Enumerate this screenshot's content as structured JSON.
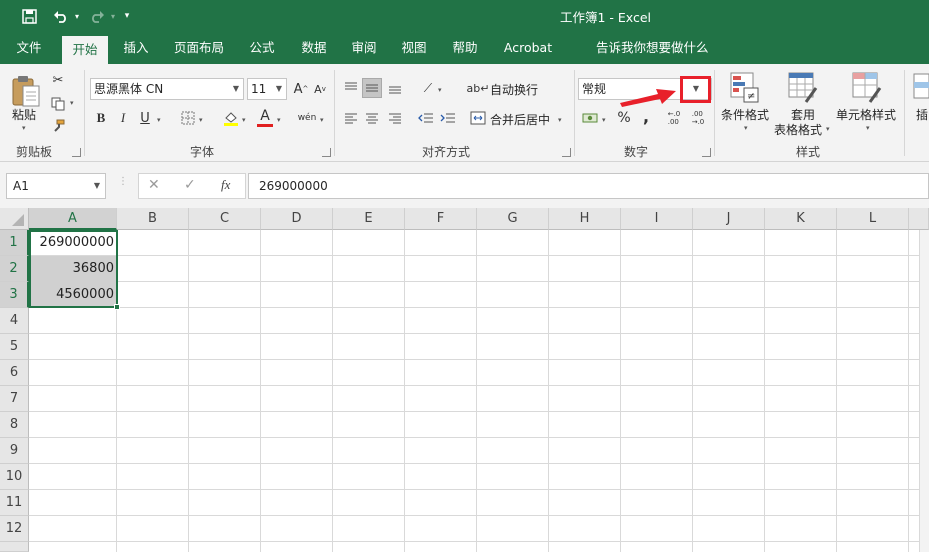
{
  "title_bar": {
    "title": "工作簿1  -  Excel",
    "save_icon": "save-icon",
    "undo_icon": "undo-icon",
    "redo_icon": "redo-icon",
    "customize_icon": "customize-qat-icon"
  },
  "tabs": [
    {
      "label": "文件"
    },
    {
      "label": "开始"
    },
    {
      "label": "插入"
    },
    {
      "label": "页面布局"
    },
    {
      "label": "公式"
    },
    {
      "label": "数据"
    },
    {
      "label": "审阅"
    },
    {
      "label": "视图"
    },
    {
      "label": "帮助"
    },
    {
      "label": "Acrobat"
    },
    {
      "label": "告诉我你想要做什么"
    }
  ],
  "ribbon": {
    "clipboard": {
      "paste_label": "粘贴",
      "group_label": "剪贴板"
    },
    "font": {
      "font_name": "思源黑体 CN",
      "font_size": "11",
      "group_label": "字体",
      "bold": "B",
      "italic": "I",
      "underline": "U",
      "wen": "wén",
      "char_a": "A"
    },
    "alignment": {
      "wrap_text": "自动换行",
      "merge_center": "合并后居中",
      "group_label": "对齐方式"
    },
    "number": {
      "format": "常规",
      "group_label": "数字",
      "percent": "%",
      "comma": ",",
      "inc_decimal": "←.0\n.00",
      "dec_decimal": ".00\n→.0"
    },
    "styles": {
      "conditional": "条件格式",
      "table_1": "套用",
      "table_2": "表格格式",
      "cell_styles": "单元格样式",
      "group_label": "样式"
    },
    "insert_partial": "插"
  },
  "formula_bar": {
    "name_box": "A1",
    "cancel": "✕",
    "enter": "✓",
    "fx": "fx",
    "content": "269000000"
  },
  "columns": [
    "A",
    "B",
    "C",
    "D",
    "E",
    "F",
    "G",
    "H",
    "I",
    "J",
    "K",
    "L"
  ],
  "rows": [
    "1",
    "2",
    "3",
    "4",
    "5",
    "6",
    "7",
    "8",
    "9",
    "10",
    "11",
    "12"
  ],
  "cells": {
    "A1": "269000000",
    "A2": "36800",
    "A3": "4560000"
  },
  "colors": {
    "accent": "#217346",
    "annotation": "#e8202a"
  }
}
